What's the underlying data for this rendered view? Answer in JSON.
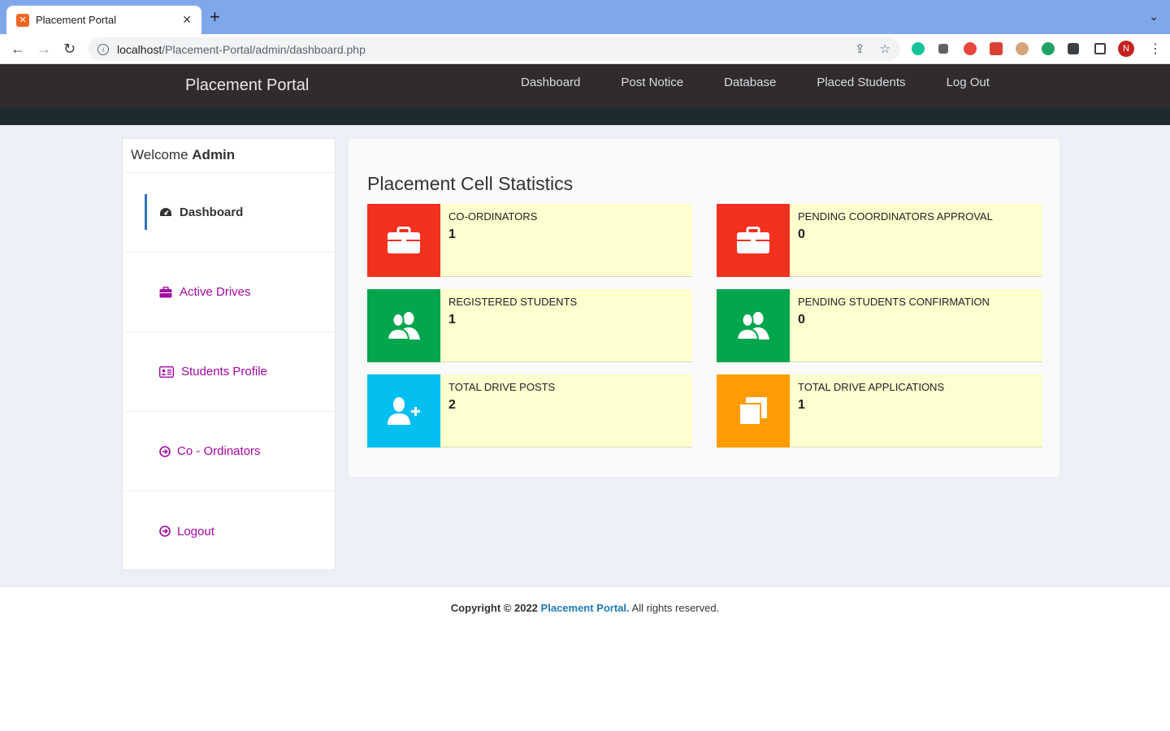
{
  "browser": {
    "tab_title": "Placement Portal",
    "url_host": "localhost",
    "url_path": "/Placement-Portal/admin/dashboard.php",
    "profile_initial": "N"
  },
  "header": {
    "brand": "Placement Portal",
    "nav": [
      "Dashboard",
      "Post Notice",
      "Database",
      "Placed Students",
      "Log Out"
    ]
  },
  "sidebar": {
    "welcome_prefix": "Welcome",
    "welcome_user": "Admin",
    "items": [
      {
        "label": "Dashboard",
        "icon": "dashboard-icon"
      },
      {
        "label": "Active Drives",
        "icon": "briefcase-icon"
      },
      {
        "label": "Students Profile",
        "icon": "id-card-icon"
      },
      {
        "label": "Co - Ordinators",
        "icon": "arrow-circle-icon"
      },
      {
        "label": "Logout",
        "icon": "arrow-circle-icon"
      }
    ]
  },
  "stats": {
    "title": "Placement Cell Statistics",
    "cards": [
      {
        "label": "CO-ORDINATORS",
        "value": "1",
        "color": "#f2311f",
        "icon": "briefcase-icon"
      },
      {
        "label": "PENDING COORDINATORS APPROVAL",
        "value": "0",
        "color": "#f2311f",
        "icon": "briefcase-icon"
      },
      {
        "label": "REGISTERED STUDENTS",
        "value": "1",
        "color": "#03a54d",
        "icon": "users-icon"
      },
      {
        "label": "PENDING STUDENTS CONFIRMATION",
        "value": "0",
        "color": "#03a54d",
        "icon": "users-icon"
      },
      {
        "label": "TOTAL DRIVE POSTS",
        "value": "2",
        "color": "#03bff0",
        "icon": "user-plus-icon"
      },
      {
        "label": "TOTAL DRIVE APPLICATIONS",
        "value": "1",
        "color": "#fc9c00",
        "icon": "copy-icon"
      }
    ]
  },
  "footer": {
    "prefix": "Copyright © 2022",
    "link": "Placement Portal.",
    "suffix": "All rights reserved."
  }
}
